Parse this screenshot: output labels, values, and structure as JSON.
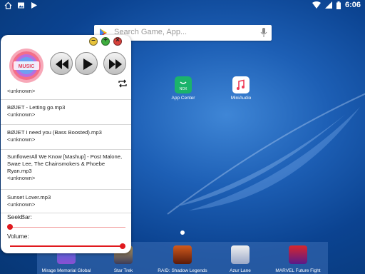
{
  "status_bar": {
    "time": "6:06"
  },
  "search": {
    "placeholder": "Search Game, App..."
  },
  "home_apps": [
    {
      "label": "App Center",
      "color": "#1bb36b"
    },
    {
      "label": "MiniAudio",
      "color": "#ffffff"
    }
  ],
  "dock": [
    {
      "label": "Mirage Memorial Global"
    },
    {
      "label": "Star Trek"
    },
    {
      "label": "RAID: Shadow Legends"
    },
    {
      "label": "Azur Lane"
    },
    {
      "label": "MARVEL Future Fight"
    }
  ],
  "player": {
    "album_text": "MUSIC",
    "list": [
      {
        "title": "",
        "artist": "<unknown>"
      },
      {
        "title": "BØJET - Letting go.mp3",
        "artist": "<unknown>"
      },
      {
        "title": "BØJET I need you (Bass Boosted).mp3",
        "artist": "<unknown>"
      },
      {
        "title": "SunflowerAll We Know [Mashup] - Post Malone, Swae Lee, The Chainsmokers & Phoebe Ryan.mp3",
        "artist": "<unknown>"
      },
      {
        "title": "Sunset Lover.mp3",
        "artist": "<unknown>"
      }
    ],
    "seek_label": "SeekBar:",
    "seek_value": 0,
    "volume_label": "Volume:",
    "volume_value": 1.0
  },
  "colors": {
    "accent": "#e0191e",
    "wallpaper": "#0a4a9c"
  }
}
